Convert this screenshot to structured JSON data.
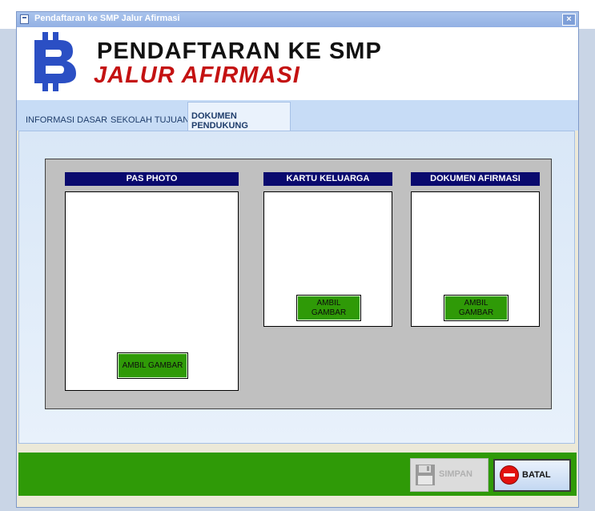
{
  "window": {
    "title": "Pendaftaran ke SMP Jalur Afirmasi",
    "close_glyph": "×"
  },
  "header": {
    "line1": "PENDAFTARAN KE SMP",
    "line2": "JALUR AFIRMASI",
    "logo_icon": "bitcoin-logo"
  },
  "tabs": [
    {
      "label": "INFORMASI DASAR",
      "active": false
    },
    {
      "label": "SEKOLAH TUJUAN",
      "active": false
    },
    {
      "label": "DOKUMEN PENDUKUNG",
      "active": true
    }
  ],
  "documents": [
    {
      "title": "PAS PHOTO",
      "button": "AMBIL GAMBAR"
    },
    {
      "title": "KARTU KELUARGA",
      "button_line1": "AMBIL",
      "button_line2": "GAMBAR"
    },
    {
      "title": "DOKUMEN AFIRMASI",
      "button_line1": "AMBIL",
      "button_line2": "GAMBAR"
    }
  ],
  "footer": {
    "save_label": "SIMPAN",
    "save_enabled": false,
    "cancel_label": "BATAL"
  },
  "colors": {
    "accent_green": "#2f9a07",
    "header_navy": "#0a0a6e",
    "title_red": "#c41212"
  }
}
